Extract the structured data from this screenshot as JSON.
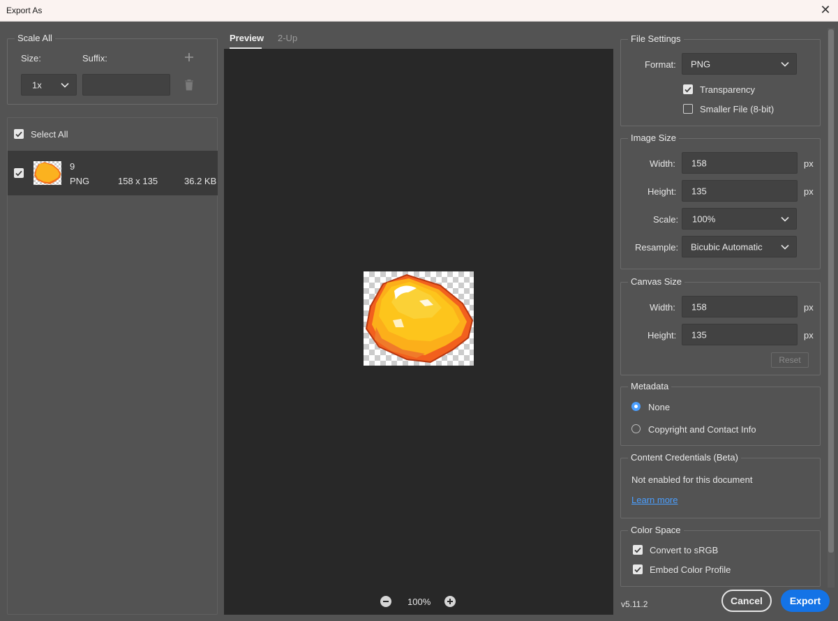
{
  "window": {
    "title": "Export As",
    "close_glyph": "✕"
  },
  "scale_all": {
    "legend": "Scale All",
    "size_label": "Size:",
    "suffix_label": "Suffix:",
    "size_value": "1x",
    "suffix_value": "",
    "add_icon": "plus-icon",
    "delete_icon": "trash-icon"
  },
  "assets": {
    "select_all_label": "Select All",
    "select_all_checked": true,
    "items": [
      {
        "name": "9",
        "format": "PNG",
        "dimensions": "158 x 135",
        "size": "36.2 KB",
        "checked": true
      }
    ]
  },
  "preview": {
    "tabs": [
      {
        "label": "Preview",
        "active": true
      },
      {
        "label": "2-Up",
        "active": false
      }
    ],
    "zoom": "100%",
    "background": "#282828"
  },
  "file_settings": {
    "legend": "File Settings",
    "format_label": "Format:",
    "format_value": "PNG",
    "transparency_label": "Transparency",
    "transparency_checked": true,
    "smaller_file_label": "Smaller File (8-bit)",
    "smaller_file_checked": false
  },
  "image_size": {
    "legend": "Image Size",
    "width_label": "Width:",
    "width_value": "158",
    "height_label": "Height:",
    "height_value": "135",
    "unit": "px",
    "scale_label": "Scale:",
    "scale_value": "100%",
    "resample_label": "Resample:",
    "resample_value": "Bicubic Automatic"
  },
  "canvas_size": {
    "legend": "Canvas Size",
    "width_label": "Width:",
    "width_value": "158",
    "height_label": "Height:",
    "height_value": "135",
    "unit": "px",
    "reset_label": "Reset"
  },
  "metadata": {
    "legend": "Metadata",
    "options": [
      {
        "label": "None",
        "selected": true
      },
      {
        "label": "Copyright and Contact Info",
        "selected": false
      }
    ]
  },
  "content_credentials": {
    "legend": "Content Credentials (Beta)",
    "status": "Not enabled for this document",
    "link": "Learn more"
  },
  "color_space": {
    "legend": "Color Space",
    "convert_label": "Convert to sRGB",
    "convert_checked": true,
    "embed_label": "Embed Color Profile",
    "embed_checked": true
  },
  "footer": {
    "version": "v5.11.2",
    "cancel_label": "Cancel",
    "export_label": "Export"
  },
  "colors": {
    "accent": "#1473e6",
    "radio_selected": "#4b9fff",
    "link": "#4b9fff",
    "panel": "#535353",
    "field": "#424242"
  }
}
